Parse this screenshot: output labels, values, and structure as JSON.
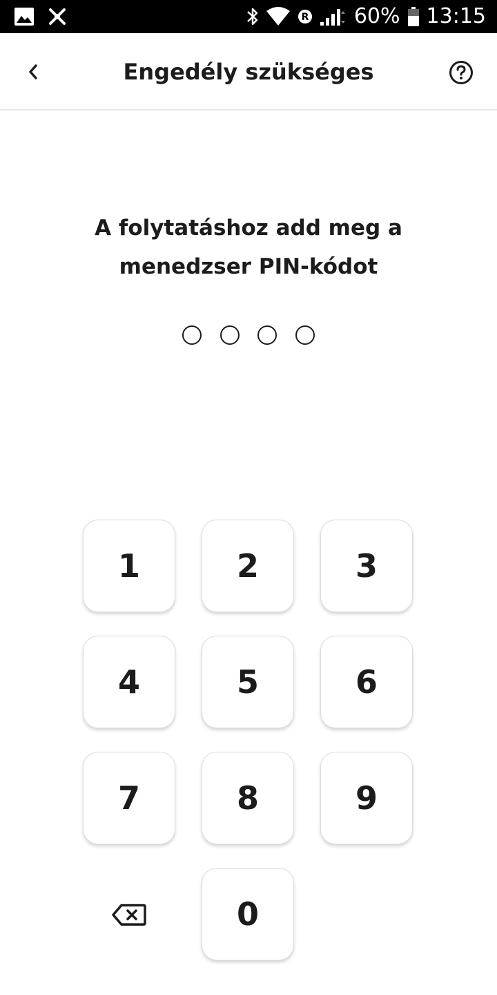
{
  "status_bar": {
    "battery_percent": "60%",
    "time": "13:15",
    "icons": [
      "image-icon",
      "mute-icon",
      "bluetooth-icon",
      "wifi-icon",
      "roaming-icon",
      "signal-icon",
      "battery-icon"
    ]
  },
  "app_bar": {
    "title": "Engedély szükséges",
    "back_icon": "chevron-left-icon",
    "help_icon": "help-circle-icon"
  },
  "prompt": {
    "text": "A folytatáshoz add meg a menedzser PIN-kódot"
  },
  "pin": {
    "length": 4,
    "entered": 0
  },
  "keypad": {
    "keys": [
      "1",
      "2",
      "3",
      "4",
      "5",
      "6",
      "7",
      "8",
      "9",
      "0"
    ],
    "backspace_icon": "backspace-icon"
  },
  "colors": {
    "text": "#1c1c1c",
    "background": "#ffffff",
    "status_bar": "#000000",
    "divider": "#e6e6e6"
  }
}
